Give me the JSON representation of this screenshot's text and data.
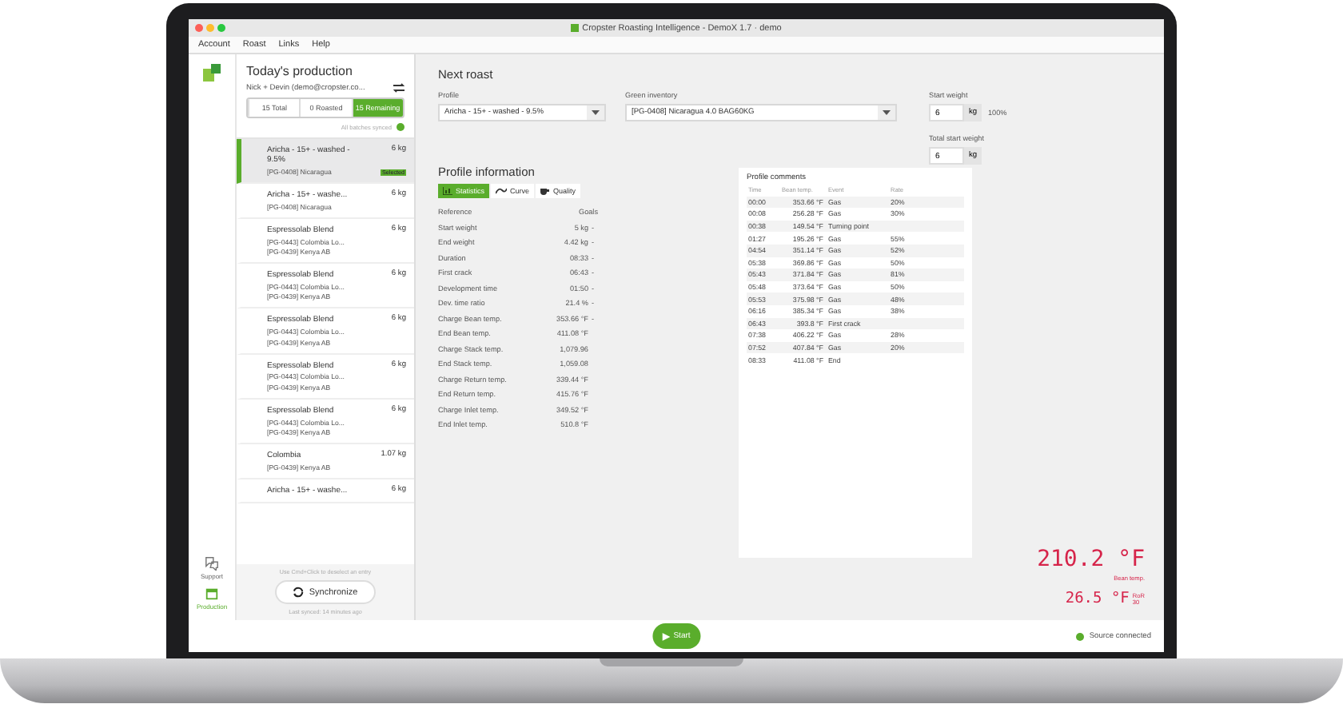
{
  "window": {
    "title": "Cropster Roasting Intelligence - DemoX 1.7 · demo"
  },
  "menu": [
    "Account",
    "Roast",
    "Links",
    "Help"
  ],
  "rail": [
    {
      "label": "Support",
      "selected": false
    },
    {
      "label": "Production",
      "selected": true
    }
  ],
  "sidebar": {
    "title": "Today's production",
    "account": "Nick + Devin (demo@cropster.co...",
    "filters": [
      {
        "label": "15 Total",
        "selected": false
      },
      {
        "label": "0 Roasted",
        "selected": false
      },
      {
        "label": "15 Remaining",
        "selected": true
      }
    ],
    "sync_status": "All batches synced",
    "batches": [
      {
        "name": "Aricha - 15+ - washed - 9.5%",
        "lots": [
          "[PG-0408] Nicaragua"
        ],
        "weight": "6 kg",
        "selected": true,
        "badge": "Selected"
      },
      {
        "name": "Aricha - 15+ - washe...",
        "lots": [
          "[PG-0408] Nicaragua"
        ],
        "weight": "6 kg",
        "selected": false
      },
      {
        "name": "Espressolab Blend",
        "lots": [
          "[PG-0443] Colombia Lo...",
          "[PG-0439] Kenya AB"
        ],
        "weight": "6 kg",
        "selected": false
      },
      {
        "name": "Espressolab Blend",
        "lots": [
          "[PG-0443] Colombia Lo...",
          "[PG-0439] Kenya AB"
        ],
        "weight": "6 kg",
        "selected": false
      },
      {
        "name": "Espressolab Blend",
        "lots": [
          "[PG-0443] Colombia Lo...",
          "[PG-0439] Kenya AB"
        ],
        "weight": "6 kg",
        "selected": false
      },
      {
        "name": "Espressolab Blend",
        "lots": [
          "[PG-0443] Colombia Lo...",
          "[PG-0439] Kenya AB"
        ],
        "weight": "6 kg",
        "selected": false
      },
      {
        "name": "Espressolab Blend",
        "lots": [
          "[PG-0443] Colombia Lo...",
          "[PG-0439] Kenya AB"
        ],
        "weight": "6 kg",
        "selected": false
      },
      {
        "name": "Colombia",
        "lots": [
          "[PG-0439] Kenya AB"
        ],
        "weight": "1.07 kg",
        "selected": false
      },
      {
        "name": "Aricha - 15+ - washe...",
        "weight": "6 kg",
        "selected": false
      }
    ],
    "hint": "Use Cmd+Click to deselect an entry",
    "sync_button": "Synchronize",
    "last_synced": "Last synced: 14 minutes ago"
  },
  "next_roast": {
    "title": "Next roast",
    "profile": {
      "label": "Profile",
      "value": "Aricha - 15+ - washed - 9.5%"
    },
    "inventory": {
      "label": "Green inventory",
      "value": "[PG-0408] Nicaragua  4.0 BAG60KG"
    },
    "start_weight": {
      "label": "Start weight",
      "value": "6",
      "unit": "kg",
      "percent": "100%"
    },
    "total_start_weight": {
      "label": "Total start weight",
      "value": "6",
      "unit": "kg"
    }
  },
  "profile_info": {
    "title": "Profile information",
    "tabs": [
      {
        "label": "Statistics",
        "selected": true
      },
      {
        "label": "Curve",
        "selected": false
      },
      {
        "label": "Quality",
        "selected": false
      }
    ],
    "statistics": {
      "columns": [
        "Reference",
        "Goals"
      ],
      "rows": [
        {
          "name": "Start weight",
          "value": "5 kg",
          "goal": "-"
        },
        {
          "name": "End weight",
          "value": "4.42 kg",
          "goal": "-"
        },
        {
          "name": "Duration",
          "value": "08:33",
          "goal": "-"
        },
        {
          "name": "First crack",
          "value": "06:43",
          "goal": "-"
        },
        {
          "name": "Development time",
          "value": "01:50",
          "goal": "-"
        },
        {
          "name": "Dev. time ratio",
          "value": "21.4 %",
          "goal": "-"
        },
        {
          "name": "Charge Bean temp.",
          "value": "353.66 °F",
          "goal": "-"
        },
        {
          "name": "End Bean temp.",
          "value": "411.08 °F"
        },
        {
          "name": "Charge Stack temp.",
          "value": "1,079.96"
        },
        {
          "name": "End Stack temp.",
          "value": "1,059.08"
        },
        {
          "name": "Charge Return temp.",
          "value": "339.44 °F"
        },
        {
          "name": "End Return temp.",
          "value": "415.76 °F"
        },
        {
          "name": "Charge Inlet temp.",
          "value": "349.52 °F"
        },
        {
          "name": "End Inlet temp.",
          "value": "510.8 °F"
        }
      ]
    },
    "comments": {
      "title": "Profile comments",
      "columns": [
        "Time",
        "Bean temp.",
        "Event",
        "Rate"
      ],
      "rows": [
        {
          "time": "00:00",
          "bean_temp": "353.66 °F",
          "event": "Gas",
          "rate": "20%"
        },
        {
          "time": "00:08",
          "bean_temp": "256.28 °F",
          "event": "Gas",
          "rate": "30%"
        },
        {
          "time": "00:38",
          "bean_temp": "149.54 °F",
          "event": "Turning point"
        },
        {
          "time": "01:27",
          "bean_temp": "195.26 °F",
          "event": "Gas",
          "rate": "55%"
        },
        {
          "time": "04:54",
          "bean_temp": "351.14 °F",
          "event": "Gas",
          "rate": "52%"
        },
        {
          "time": "05:38",
          "bean_temp": "369.86 °F",
          "event": "Gas",
          "rate": "50%"
        },
        {
          "time": "05:43",
          "bean_temp": "371.84 °F",
          "event": "Gas",
          "rate": "81%"
        },
        {
          "time": "05:48",
          "bean_temp": "373.64 °F",
          "event": "Gas",
          "rate": "50%"
        },
        {
          "time": "05:53",
          "bean_temp": "375.98 °F",
          "event": "Gas",
          "rate": "48%"
        },
        {
          "time": "06:16",
          "bean_temp": "385.34 °F",
          "event": "Gas",
          "rate": "38%"
        },
        {
          "time": "06:43",
          "bean_temp": "393.8 °F",
          "event": "First crack"
        },
        {
          "time": "07:38",
          "bean_temp": "406.22 °F",
          "event": "Gas",
          "rate": "28%"
        },
        {
          "time": "07:52",
          "bean_temp": "407.84 °F",
          "event": "Gas",
          "rate": "20%"
        },
        {
          "time": "08:33",
          "bean_temp": "411.08 °F",
          "event": "End"
        }
      ]
    }
  },
  "readings": {
    "bean": {
      "value": "210.2 °F",
      "label": "Bean temp."
    },
    "ror": {
      "value": "26.5 °F",
      "label": "RoR",
      "unit": "30"
    }
  },
  "footer": {
    "start": "Start",
    "source": "Source connected"
  }
}
